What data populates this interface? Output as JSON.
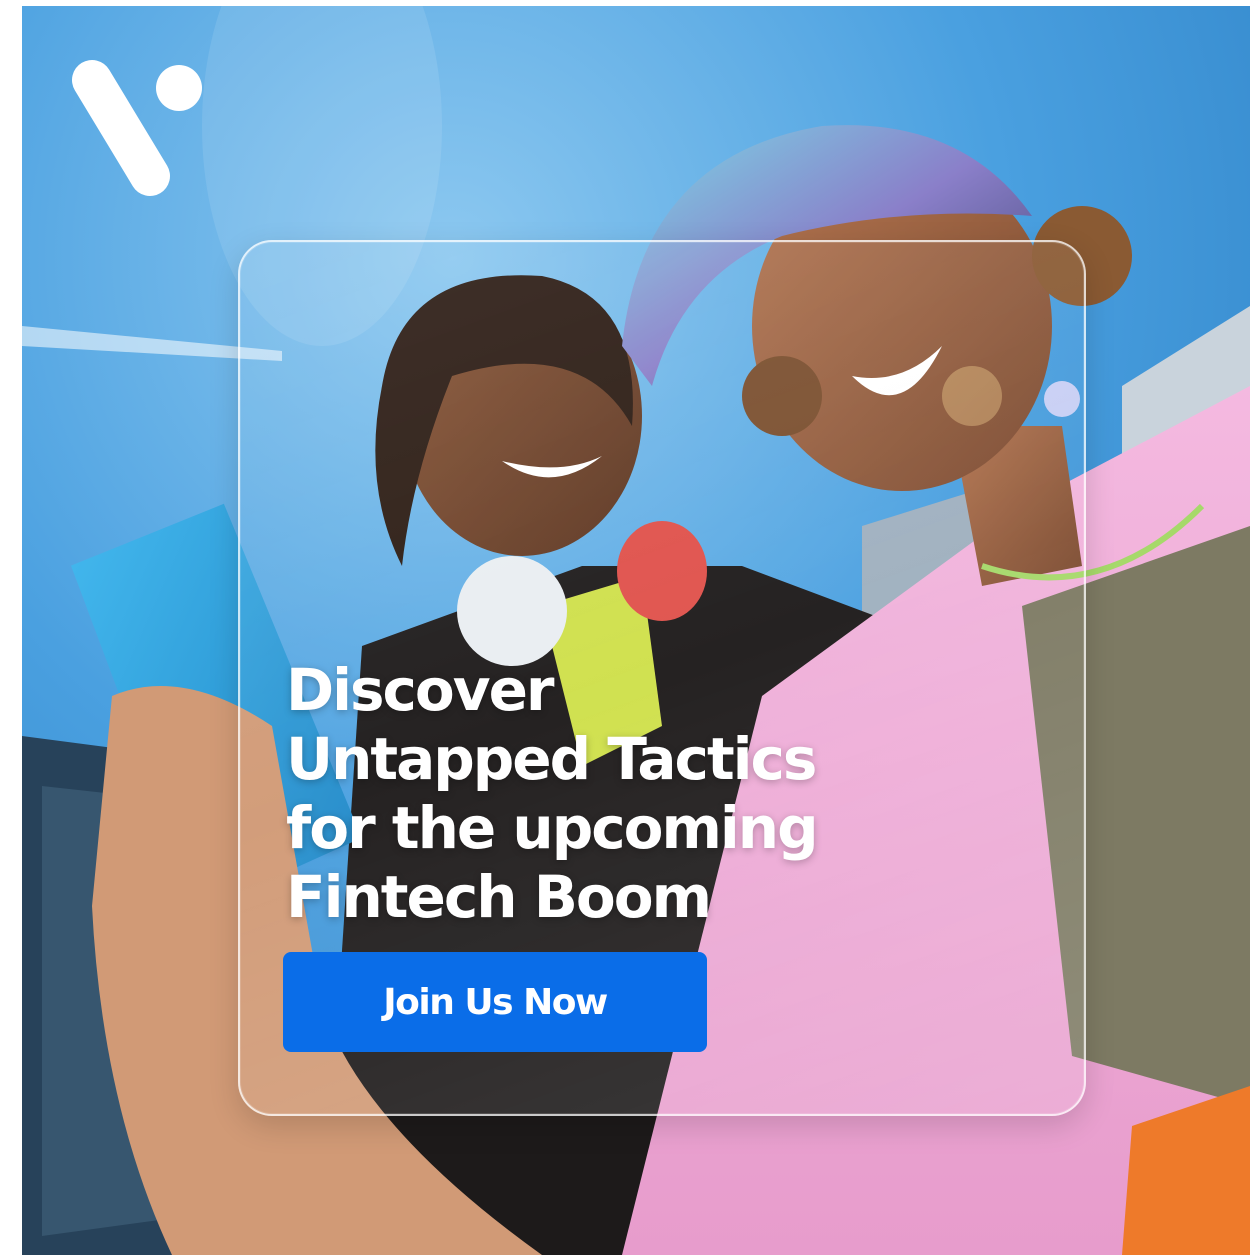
{
  "brand": {
    "logo_icon": "v-logo-icon"
  },
  "hero": {
    "image": "two-smiling-young-people-with-phone-photo",
    "headline_lines": [
      "Discover",
      "Untapped Tactics",
      "for the upcoming",
      "Fintech Boom"
    ]
  },
  "cta": {
    "label": "Join Us Now",
    "color": "#0a6de8"
  }
}
